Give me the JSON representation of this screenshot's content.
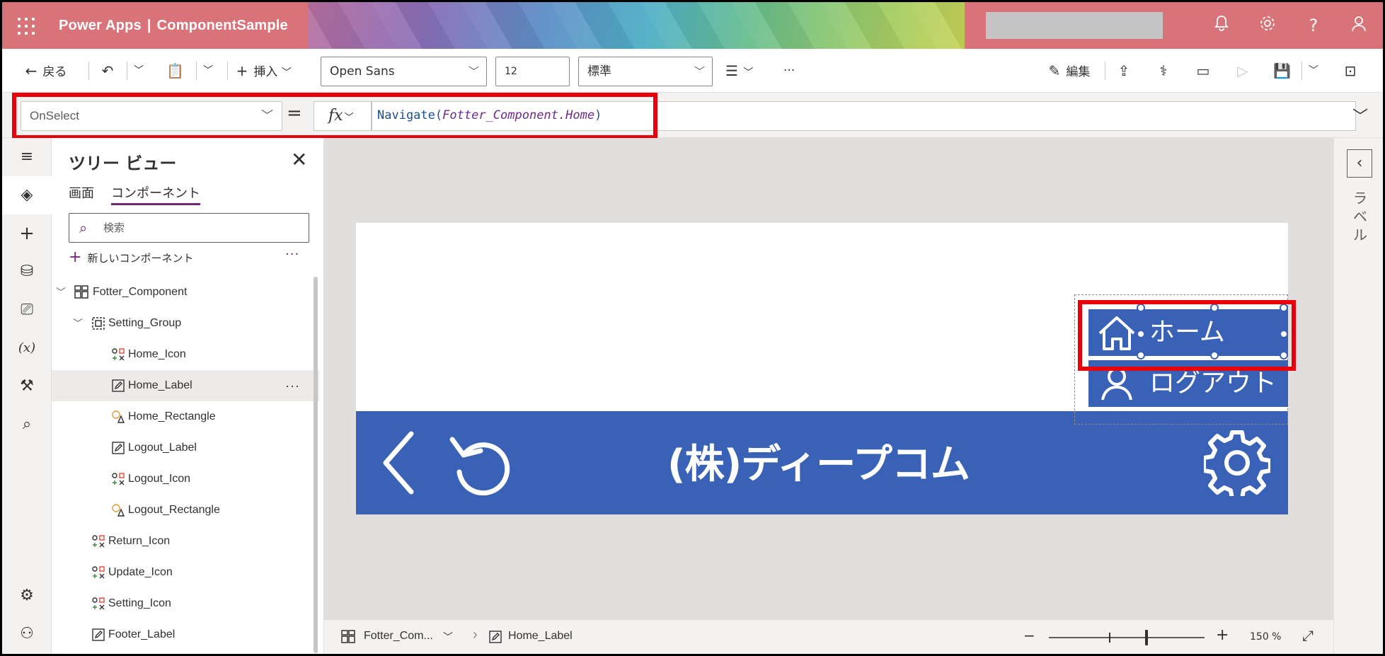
{
  "topbar": {
    "app_name": "Power Apps",
    "separator": "|",
    "doc_name": "ComponentSample"
  },
  "commands": {
    "back": "戻る",
    "insert": "挿入",
    "font": "Open Sans",
    "font_size": "12",
    "weight": "標準",
    "edit": "編集",
    "more": "···"
  },
  "formula": {
    "property": "OnSelect",
    "equals": "=",
    "fx": "fx",
    "fn": "Navigate",
    "open": "(",
    "arg": "Fotter_Component.Home",
    "close": ")"
  },
  "tree": {
    "title": "ツリー ビュー",
    "tabs": [
      "画面",
      "コンポーネント"
    ],
    "search_placeholder": "検索",
    "new_component": "新しいコンポーネント",
    "items": [
      {
        "label": "Fotter_Component",
        "type": "component"
      },
      {
        "label": "Setting_Group",
        "type": "group"
      },
      {
        "label": "Home_Icon",
        "type": "icon"
      },
      {
        "label": "Home_Label",
        "type": "label",
        "selected": true
      },
      {
        "label": "Home_Rectangle",
        "type": "shape"
      },
      {
        "label": "Logout_Label",
        "type": "label"
      },
      {
        "label": "Logout_Icon",
        "type": "icon"
      },
      {
        "label": "Logout_Rectangle",
        "type": "shape"
      },
      {
        "label": "Return_Icon",
        "type": "icon"
      },
      {
        "label": "Update_Icon",
        "type": "icon"
      },
      {
        "label": "Setting_Icon",
        "type": "icon"
      },
      {
        "label": "Footer_Label",
        "type": "label"
      }
    ]
  },
  "canvas": {
    "footer_title": "(株)ディープコム",
    "menu_home": "ホーム",
    "menu_logout": "ログアウト",
    "accent": "#3961b5"
  },
  "right_panel": {
    "label": "ラベル"
  },
  "status": {
    "crumb_component": "Fotter_Com...",
    "crumb_control": "Home_Label",
    "zoom": "150 %"
  }
}
